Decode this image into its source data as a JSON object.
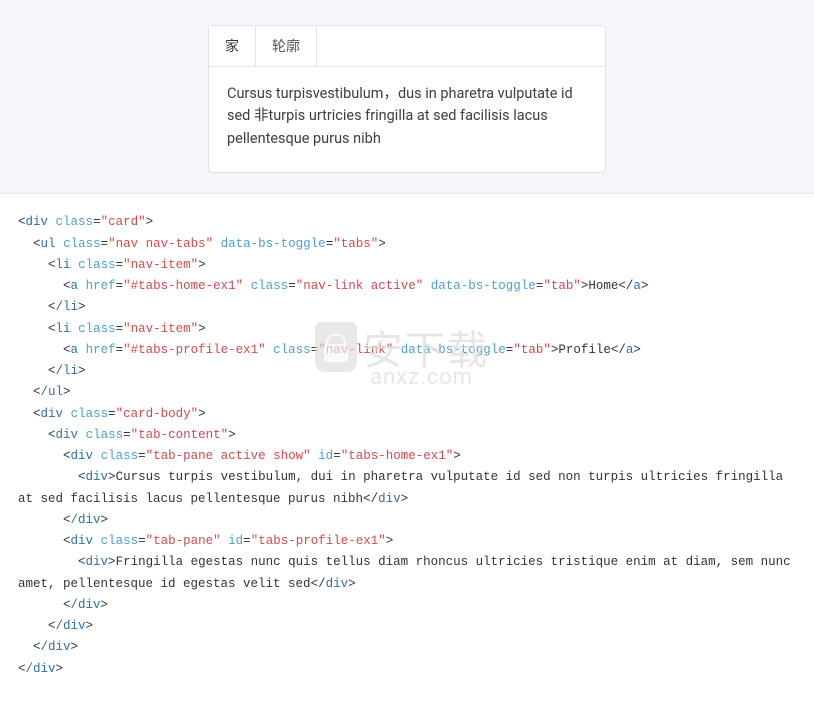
{
  "demo": {
    "tabs": [
      {
        "label": "家",
        "active": true
      },
      {
        "label": "轮廓",
        "active": false
      }
    ],
    "content": "Cursus turpisvestibulum，dus in pharetra vulputate id sed 非turpis urtricies fringilla at sed facilisis lacus pellentesque purus nibh"
  },
  "watermark": {
    "text": "安下载",
    "sub": "anxz.com"
  },
  "code": {
    "l1_tag": "div",
    "l1_attr_class": "class",
    "l1_val_class": "card",
    "l2_tag": "ul",
    "l2_attr_class": "class",
    "l2_val_class": "nav nav-tabs",
    "l2_attr_toggle": "data-bs-toggle",
    "l2_val_toggle": "tabs",
    "l3_tag": "li",
    "l3_attr_class": "class",
    "l3_val_class": "nav-item",
    "l4_tag": "a",
    "l4_attr_href": "href",
    "l4_val_href": "#tabs-home-ex1",
    "l4_attr_class": "class",
    "l4_val_class": "nav-link active",
    "l4_attr_toggle": "data-bs-toggle",
    "l4_val_toggle": "tab",
    "l4_text": "Home",
    "l5_close": "/li",
    "l6_tag": "li",
    "l6_attr_class": "class",
    "l6_val_class": "nav-item",
    "l7_tag": "a",
    "l7_attr_href": "href",
    "l7_val_href": "#tabs-profile-ex1",
    "l7_attr_class": "class",
    "l7_val_class": "nav-link",
    "l7_attr_toggle": "data-bs-toggle",
    "l7_val_toggle": "tab",
    "l7_text": "Profile",
    "l8_close": "/li",
    "l9_close": "/ul",
    "l10_tag": "div",
    "l10_attr_class": "class",
    "l10_val_class": "card-body",
    "l11_tag": "div",
    "l11_attr_class": "class",
    "l11_val_class": "tab-content",
    "l12_tag": "div",
    "l12_attr_class": "class",
    "l12_val_class": "tab-pane active show",
    "l12_attr_id": "id",
    "l12_val_id": "tabs-home-ex1",
    "l13_tag": "div",
    "l13_text": "Cursus turpis vestibulum, dui in pharetra vulputate id sed non turpis ultricies fringilla at sed facilisis lacus pellentesque purus nibh",
    "l14_close": "/div",
    "l15_tag": "div",
    "l15_attr_class": "class",
    "l15_val_class": "tab-pane",
    "l15_attr_id": "id",
    "l15_val_id": "tabs-profile-ex1",
    "l16_tag": "div",
    "l16_text": "Fringilla egestas nunc quis tellus diam rhoncus ultricies tristique enim at diam, sem nunc amet, pellentesque id egestas velit sed",
    "l17_close": "/div",
    "l18_close": "/div",
    "l19_close": "/div",
    "l20_close": "/div"
  }
}
